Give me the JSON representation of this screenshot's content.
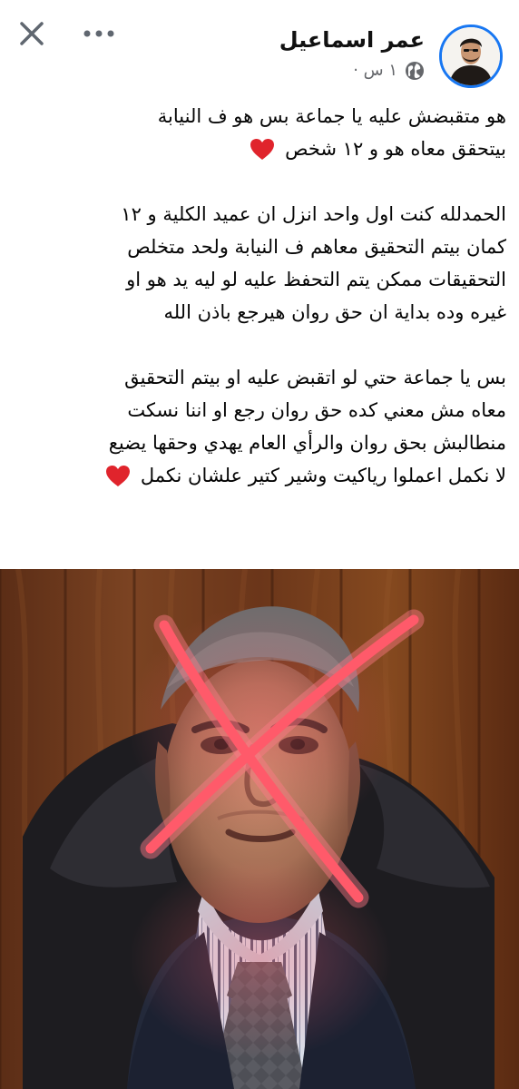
{
  "header": {
    "author_name": "عمر اسماعيل",
    "timestamp": "١ س ·",
    "close_icon": "close-icon",
    "more_icon": "more-options-icon",
    "privacy_icon": "globe-icon"
  },
  "post": {
    "lines": [
      "هو متقبضش عليه يا جماعة بس هو ف النيابة",
      "بيتحقق معاه هو و ١٢ شخص",
      "",
      "الحمدلله كنت اول واحد انزل ان عميد الكلية و ١٢",
      "كمان بيتم التحقيق معاهم ف النيابة ولحد متخلص",
      "التحقيقات ممكن يتم التحفظ عليه لو ليه يد هو او",
      "غيره وده بداية ان حق روان هيرجع باذن الله",
      "",
      "بس يا جماعة حتي لو اتقبض عليه او بيتم التحقيق",
      "معاه مش معني كده حق روان رجع او اننا نسكت",
      "منطالبش بحق روان والرأي العام يهدي وحقها يضيع",
      "لا نكمل اعملوا رياكيت وشير كتير علشان نكمل"
    ],
    "heart_color": "#e0242c"
  },
  "photo": {
    "description_icon": "crossed-out-photo",
    "cross_color": "#ff5a6a"
  },
  "colors": {
    "accent": "#1877f2",
    "secondary_text": "#65676b"
  }
}
